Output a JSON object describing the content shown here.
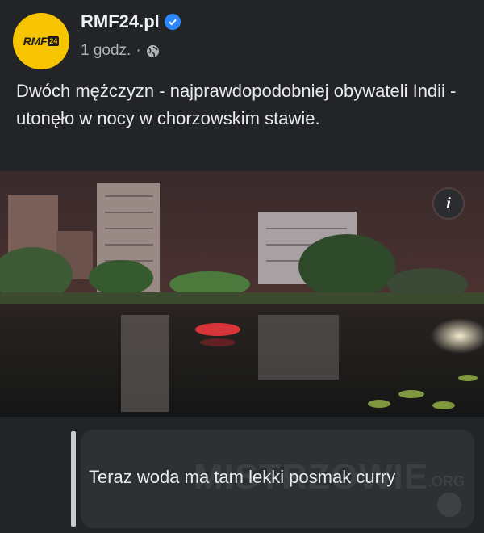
{
  "post": {
    "page_name": "RMF24.pl",
    "logo_text": "RMF",
    "logo_badge": "24",
    "time": "1 godz.",
    "separator": "·",
    "privacy_icon": "globe-icon",
    "verified_icon": "verified-badge-icon",
    "text": "Dwóch mężczyzn - najprawdopodobniej obywateli Indii - utonęło w nocy w chorzowskim stawie.",
    "info_label": "i"
  },
  "comment": {
    "text": "Teraz woda ma tam lekki posmak curry"
  },
  "watermark": {
    "text": "MISTRZOWIE",
    "suffix": ".ORG"
  },
  "colors": {
    "background": "#232427",
    "logo_yellow": "#f6c400",
    "verified_blue": "#2d88ff",
    "comment_bg": "#2e3034"
  }
}
